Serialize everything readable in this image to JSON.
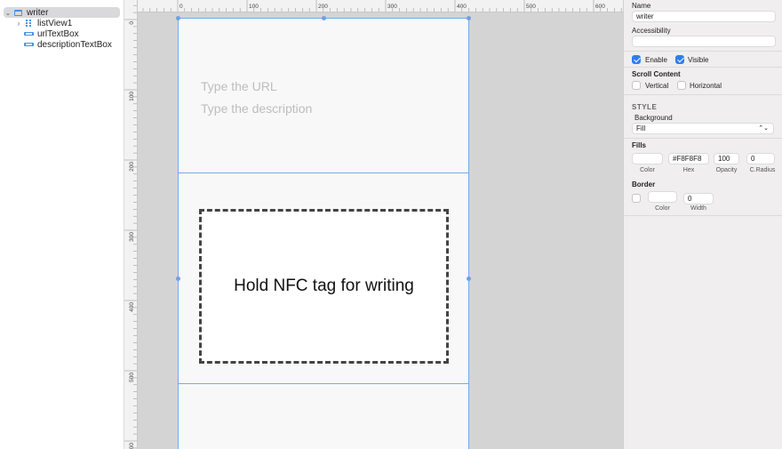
{
  "outline": {
    "items": [
      {
        "label": "writer",
        "arrow": "⌄"
      },
      {
        "label": "listView1",
        "arrow": "›"
      },
      {
        "label": "urlTextBox"
      },
      {
        "label": "descriptionTextBox"
      }
    ]
  },
  "rulers": {
    "horizontal_labels": [
      "0",
      "100",
      "200",
      "300",
      "400",
      "500",
      "600"
    ],
    "vertical_labels": [
      "0",
      "100",
      "200",
      "300",
      "400",
      "500",
      "00"
    ]
  },
  "canvas": {
    "url_placeholder": "Type the URL",
    "description_placeholder": "Type the description",
    "nfc_text": "Hold NFC tag for writing"
  },
  "inspector": {
    "name_label": "Name",
    "name_value": "writer",
    "accessibility_label": "Accessibility",
    "accessibility_value": "",
    "enable_label": "Enable",
    "visible_label": "Visible",
    "scroll_content_label": "Scroll Content",
    "vertical_label": "Vertical",
    "horizontal_label": "Horizontal",
    "style_label": "STYLE",
    "background_label": "Background",
    "background_value": "Fill",
    "background_chevron": "⌃⌄",
    "fills_label": "Fills",
    "fill_hex": "#F8F8F8",
    "fill_opacity": "100",
    "fill_radius": "0",
    "color_caption": "Color",
    "hex_caption": "Hex",
    "opacity_caption": "Opacity",
    "radius_caption": "C.Radius",
    "border_label": "Border",
    "border_color_caption": "Color",
    "border_width_value": "0",
    "width_caption": "Width"
  },
  "colors": {
    "accent": "#2f7cf6",
    "selection": "#7aa7ea",
    "artboard_fill": "#F8F8F8"
  }
}
